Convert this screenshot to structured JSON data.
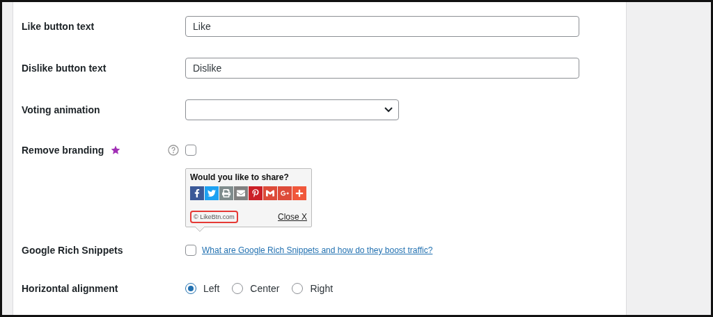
{
  "rows": [
    {
      "kind": "text",
      "label": "Like button text",
      "value": "Like"
    },
    {
      "kind": "text",
      "label": "Dislike button text",
      "value": "Dislike"
    },
    {
      "kind": "select",
      "label": "Voting animation"
    },
    {
      "kind": "branding",
      "label": "Remove branding",
      "premium": true,
      "checked": false,
      "preview": {
        "title": "Would you like to share?",
        "credit": "© LikeBtn.com",
        "close": "Close X"
      }
    },
    {
      "kind": "checkbox_link",
      "label": "Google Rich Snippets",
      "checked": false,
      "link": "What are Google Rich Snippets and how do they boost traffic?"
    },
    {
      "kind": "radio",
      "label": "Horizontal alignment",
      "options": [
        {
          "label": "Left",
          "selected": true
        },
        {
          "label": "Center",
          "selected": false
        },
        {
          "label": "Right",
          "selected": false
        }
      ]
    }
  ]
}
